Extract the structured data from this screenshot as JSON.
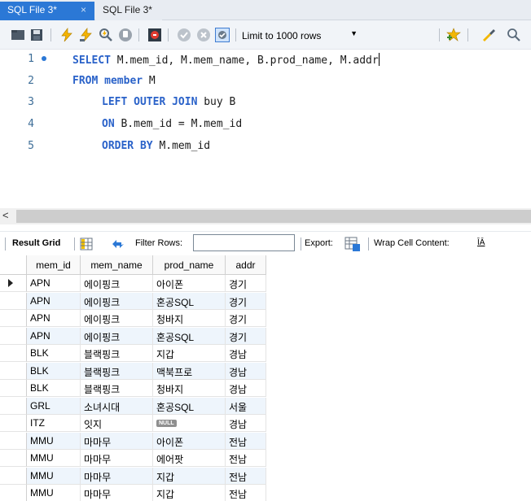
{
  "tabs": [
    {
      "label": "SQL File 3*",
      "close": "×",
      "active": true
    },
    {
      "label": "SQL File 3*",
      "active": false
    }
  ],
  "toolbar": {
    "limit_label": "Limit to 1000 rows",
    "limit_dropdown": "▼",
    "icons": [
      "open-folder-icon",
      "save-icon",
      "execute-icon",
      "execute-statement-icon",
      "explain-icon",
      "stop-icon",
      "toggle-errors-icon",
      "commit-icon",
      "rollback-icon",
      "autocommit-icon",
      "add-snippet-icon",
      "beautify-icon",
      "find-icon"
    ]
  },
  "editor": {
    "lines": [
      {
        "num": "1",
        "tokens": [
          {
            "t": "SELECT",
            "kw": true
          },
          {
            "t": " M.mem_id, M.mem_name, B.prod_name, M.addr",
            "kw": false
          }
        ],
        "bullet": true,
        "cursor": true
      },
      {
        "num": "2",
        "tokens": [
          {
            "t": "FROM",
            "kw": true
          },
          {
            "t": " ",
            "kw": false
          },
          {
            "t": "member",
            "kw": true
          },
          {
            "t": " M",
            "kw": false
          }
        ]
      },
      {
        "num": "3",
        "tokens": [
          {
            "t": "LEFT OUTER JOIN",
            "kw": true
          },
          {
            "t": " buy B",
            "kw": false
          }
        ],
        "indent": true
      },
      {
        "num": "4",
        "tokens": [
          {
            "t": "ON",
            "kw": true
          },
          {
            "t": " B.mem_id = M.mem_id",
            "kw": false
          }
        ],
        "indent": true
      },
      {
        "num": "5",
        "tokens": [
          {
            "t": "ORDER BY",
            "kw": true
          },
          {
            "t": " M.mem_id",
            "kw": false
          }
        ],
        "indent": true
      }
    ]
  },
  "scrollbar": {
    "left_arrow": "<"
  },
  "result_toolbar": {
    "result_grid": "Result Grid",
    "filter_rows": "Filter Rows:",
    "filter_value": "",
    "export": "Export:",
    "wrap_cell": "Wrap Cell Content:",
    "wrap_icon_glyph": "ĪĀ"
  },
  "grid": {
    "columns": [
      "mem_id",
      "mem_name",
      "prod_name",
      "addr"
    ],
    "rows": [
      [
        "APN",
        "에이핑크",
        "아이폰",
        "경기"
      ],
      [
        "APN",
        "에이핑크",
        "혼공SQL",
        "경기"
      ],
      [
        "APN",
        "에이핑크",
        "청바지",
        "경기"
      ],
      [
        "APN",
        "에이핑크",
        "혼공SQL",
        "경기"
      ],
      [
        "BLK",
        "블랙핑크",
        "지갑",
        "경남"
      ],
      [
        "BLK",
        "블랙핑크",
        "맥북프로",
        "경남"
      ],
      [
        "BLK",
        "블랙핑크",
        "청바지",
        "경남"
      ],
      [
        "GRL",
        "소녀시대",
        "혼공SQL",
        "서울"
      ],
      [
        "ITZ",
        "잇지",
        "NULL",
        "경남"
      ],
      [
        "MMU",
        "마마무",
        "아이폰",
        "전남"
      ],
      [
        "MMU",
        "마마무",
        "에어팟",
        "전남"
      ],
      [
        "MMU",
        "마마무",
        "지갑",
        "전남"
      ],
      [
        "MMU",
        "마마무",
        "지갑",
        "전남"
      ]
    ],
    "null_token": "NULL",
    "selected_row": 0
  }
}
